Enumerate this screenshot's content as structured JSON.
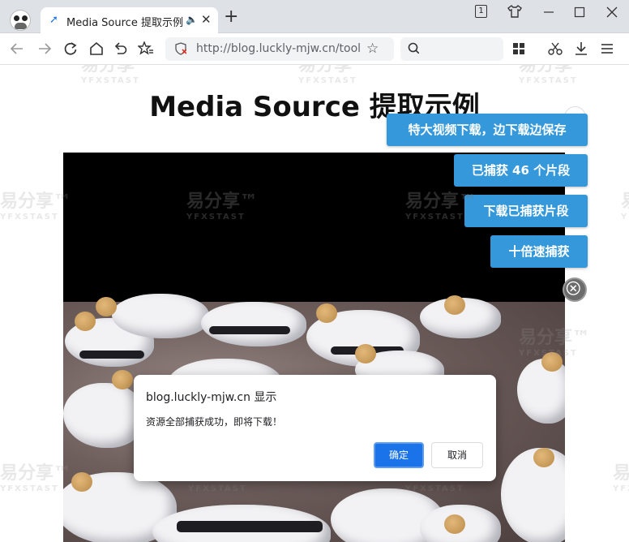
{
  "browser": {
    "tab_title": "Media Source 提取示例",
    "tab_count": "1",
    "address_url": "http://blog.luckly-mjw.cn/tool"
  },
  "page": {
    "title": "Media Source 提取示例"
  },
  "side_buttons": {
    "big_download": "特大视频下载，边下载边保存",
    "captured_count": "已捕获 46 个片段",
    "download_captured": "下载已捕获片段",
    "speed_capture": "十倍速捕获"
  },
  "dialog": {
    "title": "blog.luckly-mjw.cn 显示",
    "message": "资源全部捕获成功，即将下载！",
    "ok_label": "确定",
    "cancel_label": "取消"
  },
  "watermark": {
    "text": "易分享™",
    "sub": "YFXSTAST"
  },
  "colors": {
    "accent_button": "#3498db",
    "dialog_ok": "#1a73e8"
  },
  "icons": [
    "browser-logo-icon",
    "audio-icon",
    "close-tab-icon",
    "new-tab-icon",
    "tab-count-icon",
    "shirt-icon",
    "minimize-icon",
    "maximize-icon",
    "close-window-icon",
    "back-icon",
    "forward-icon",
    "reload-icon",
    "home-icon",
    "undo-icon",
    "favorites-icon",
    "security-shield-icon",
    "star-icon",
    "search-icon",
    "apps-grid-icon",
    "scissors-icon",
    "download-icon",
    "menu-icon",
    "close-circle-icon"
  ]
}
